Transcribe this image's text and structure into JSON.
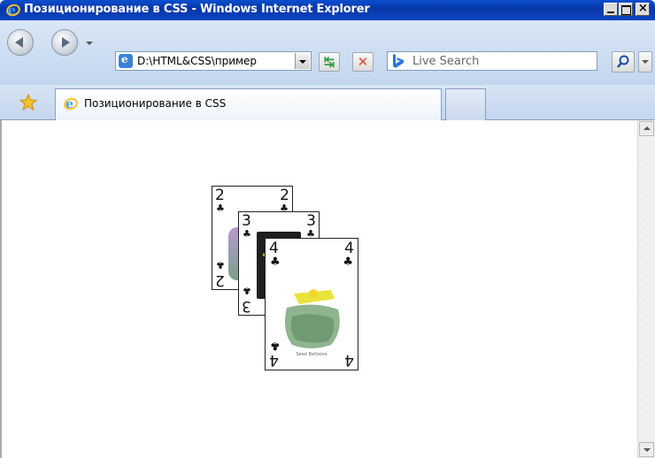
{
  "window": {
    "title": "Позиционирование в CSS - Windows Internet Explorer",
    "controls": {
      "minimize": "_",
      "maximize": "□",
      "close": "×"
    }
  },
  "navbar": {
    "address_value": "D:\\HTML&CSS\\пример",
    "search_placeholder": "Live Search"
  },
  "tab": {
    "label": "Позиционирование в CSS"
  },
  "cards": [
    {
      "rank": "2",
      "suit": "♣"
    },
    {
      "rank": "3",
      "suit": "♣"
    },
    {
      "rank": "4",
      "suit": "♣",
      "caption": "Seed Balloons"
    }
  ],
  "colors": {
    "titlebar": "#0a4fd0",
    "chrome": "#d3e1f4",
    "close_red": "#d94b2b",
    "refresh_green": "#2e9b3e"
  },
  "icons": [
    "ie-logo-icon",
    "back-icon",
    "forward-icon",
    "favorites-star-icon",
    "refresh-icon",
    "stop-icon",
    "bing-icon",
    "search-icon"
  ]
}
